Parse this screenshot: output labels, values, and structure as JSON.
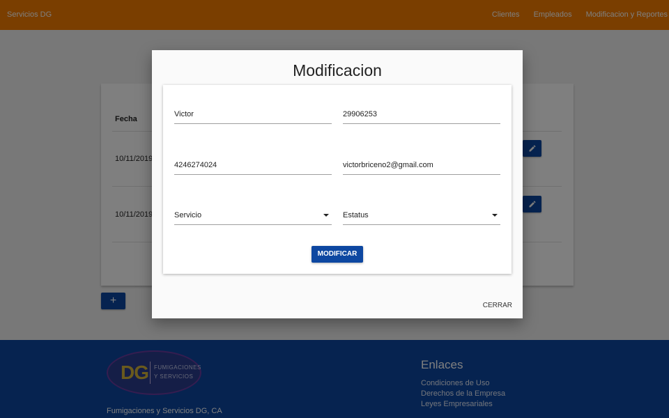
{
  "navbar": {
    "brand": "Servicios DG",
    "links": [
      "Clientes",
      "Empleados",
      "Modificacion y Reportes"
    ]
  },
  "table": {
    "header_fecha": "Fecha",
    "rows": [
      {
        "fecha": "10/11/2019"
      },
      {
        "fecha": "10/11/2019"
      }
    ],
    "add_label": "+"
  },
  "footer": {
    "logo_dg": "DG",
    "logo_line1": "FUMIGACIONES",
    "logo_line2": "Y SERVICIOS",
    "company": "Fumigaciones y Servicios DG, CA",
    "links_heading": "Enlaces",
    "links": [
      "Condiciones de Uso",
      "Derechos de la Empresa",
      "Leyes Empresariales"
    ]
  },
  "modal": {
    "title": "Modificacion",
    "fields": {
      "nombre": "Victor",
      "cedula": "29906253",
      "telefono": "4246274024",
      "email": "victorbriceno2@gmail.com",
      "servicio": "Servicio",
      "estatus": "Estatus"
    },
    "submit_label": "MODIFICAR",
    "close_label": "CERRAR"
  },
  "colors": {
    "navbar": "#f57c00",
    "primary": "#0d47a1",
    "overlay": "rgba(0,0,0,0.5)"
  }
}
